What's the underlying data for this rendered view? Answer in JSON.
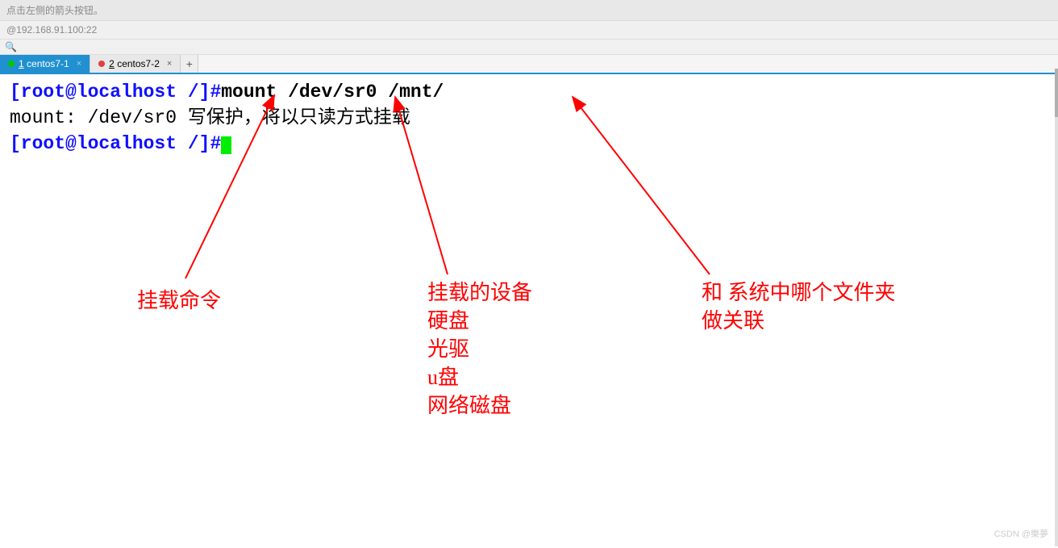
{
  "header": {
    "hint": "点击左侧的箭头按钮。",
    "address": "@192.168.91.100:22"
  },
  "tabs": {
    "tab1_num": "1",
    "tab1_label": " centos7-1",
    "tab2_num": "2",
    "tab2_label": " centos7-2",
    "close_glyph": "×",
    "add_glyph": "+"
  },
  "terminal": {
    "prompt1": "[root@localhost /]#",
    "cmd1": "mount  /dev/sr0    /mnt/",
    "output": "mount: /dev/sr0 写保护，将以只读方式挂载",
    "prompt2": "[root@localhost /]#"
  },
  "annotations": {
    "a1": "挂载命令",
    "a2": "挂载的设备\n硬盘\n光驱\nu盘\n网络磁盘",
    "a3": "和 系统中哪个文件夹\n做关联"
  },
  "watermark": "CSDN @樂夢"
}
